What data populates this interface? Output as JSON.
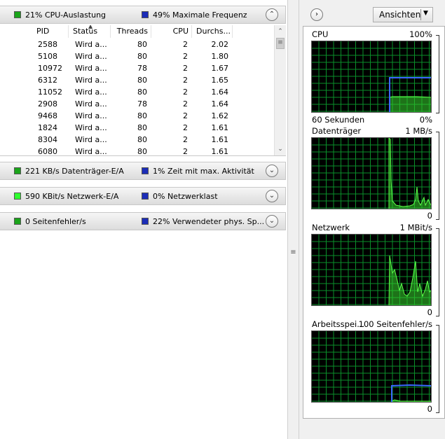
{
  "colors": {
    "graph_grid": "#0a8f2a",
    "graph_fill": "#36d12e",
    "graph_line": "#3a67ff",
    "swatch_green": "#1aa41a",
    "swatch_blue": "#1c2db8",
    "swatch_bright_green": "#2eff2e"
  },
  "cpu_section": {
    "metric1": "21% CPU-Auslastung",
    "metric2": "49% Maximale Frequenz",
    "columns": [
      "PID",
      "Status",
      "Threads",
      "CPU",
      "Durchs..."
    ],
    "rows": [
      {
        "pid": "2588",
        "status": "Wird a...",
        "threads": "80",
        "cpu": "2",
        "avg": "2.02"
      },
      {
        "pid": "5108",
        "status": "Wird a...",
        "threads": "80",
        "cpu": "2",
        "avg": "1.80"
      },
      {
        "pid": "10972",
        "status": "Wird a...",
        "threads": "78",
        "cpu": "2",
        "avg": "1.67"
      },
      {
        "pid": "6312",
        "status": "Wird a...",
        "threads": "80",
        "cpu": "2",
        "avg": "1.65"
      },
      {
        "pid": "11052",
        "status": "Wird a...",
        "threads": "80",
        "cpu": "2",
        "avg": "1.64"
      },
      {
        "pid": "2908",
        "status": "Wird a...",
        "threads": "78",
        "cpu": "2",
        "avg": "1.64"
      },
      {
        "pid": "9468",
        "status": "Wird a...",
        "threads": "80",
        "cpu": "2",
        "avg": "1.62"
      },
      {
        "pid": "1824",
        "status": "Wird a...",
        "threads": "80",
        "cpu": "2",
        "avg": "1.61"
      },
      {
        "pid": "8304",
        "status": "Wird a...",
        "threads": "80",
        "cpu": "2",
        "avg": "1.61"
      },
      {
        "pid": "6080",
        "status": "Wird a...",
        "threads": "80",
        "cpu": "2",
        "avg": "1.61"
      }
    ]
  },
  "disk_section": {
    "metric1": "221 KB/s Datenträger-E/A",
    "metric2": "1% Zeit mit max. Aktivität"
  },
  "network_section": {
    "metric1": "590 KBit/s Netzwerk-E/A",
    "metric2": "0% Netzwerklast"
  },
  "memory_section": {
    "metric1": "0 Seitenfehler/s",
    "metric2": "22% Verwendeter phys. Sp..."
  },
  "right_panel": {
    "views_button": "Ansichten",
    "graphs": [
      {
        "title": "CPU",
        "max": "100%",
        "time_label": "60 Sekunden",
        "min": "0%"
      },
      {
        "title": "Datenträger",
        "max": "1 MB/s",
        "min": "0"
      },
      {
        "title": "Netzwerk",
        "max": "1 MBit/s",
        "min": "0"
      },
      {
        "title": "Arbeitsspei...",
        "max": "100 Seitenfehler/s",
        "min": "0"
      }
    ]
  }
}
